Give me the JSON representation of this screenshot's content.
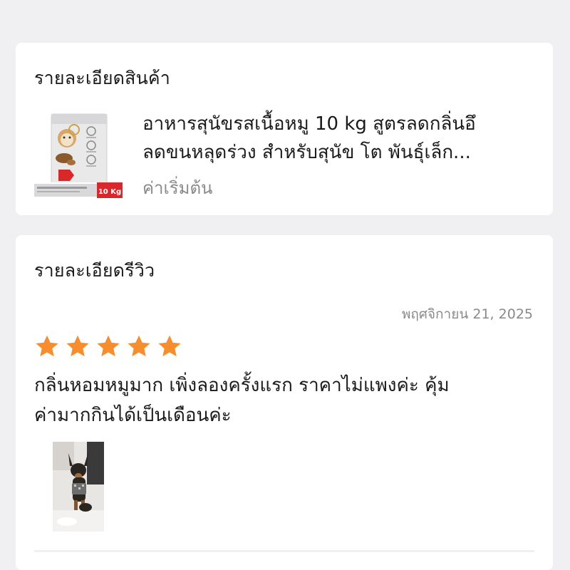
{
  "product_section": {
    "title": "รายละเอียดสินค้า",
    "product": {
      "name_line1": "อาหารสุนัขรสเนื้อหมู 10 kg สูตรลดกลิ่นอึ",
      "name_line2": "ลดขนหลุดร่วง  สำหรับสุนัข โต พันธุ์เล็ก...",
      "price_label": "ค่าเริ่มต้น",
      "image": {
        "icon": "dog-food-bag-image",
        "badge_text": "10 Kg",
        "accent_color": "#d8282b"
      }
    }
  },
  "review_section": {
    "title": "รายละเอียดรีวิว",
    "date": "พฤศจิกายน 21, 2025",
    "rating": 5,
    "rating_max": 5,
    "star_color": "#f68d2e",
    "text_line1": "กลิ่นหอมหมูมาก เพิ่งลองครั้งแรก ราคาไม่แพงค่ะ คุ้ม",
    "text_line2": "ค่ามากกินได้เป็นเดือนค่ะ",
    "photo": {
      "icon": "dog-photo-thumbnail"
    }
  }
}
